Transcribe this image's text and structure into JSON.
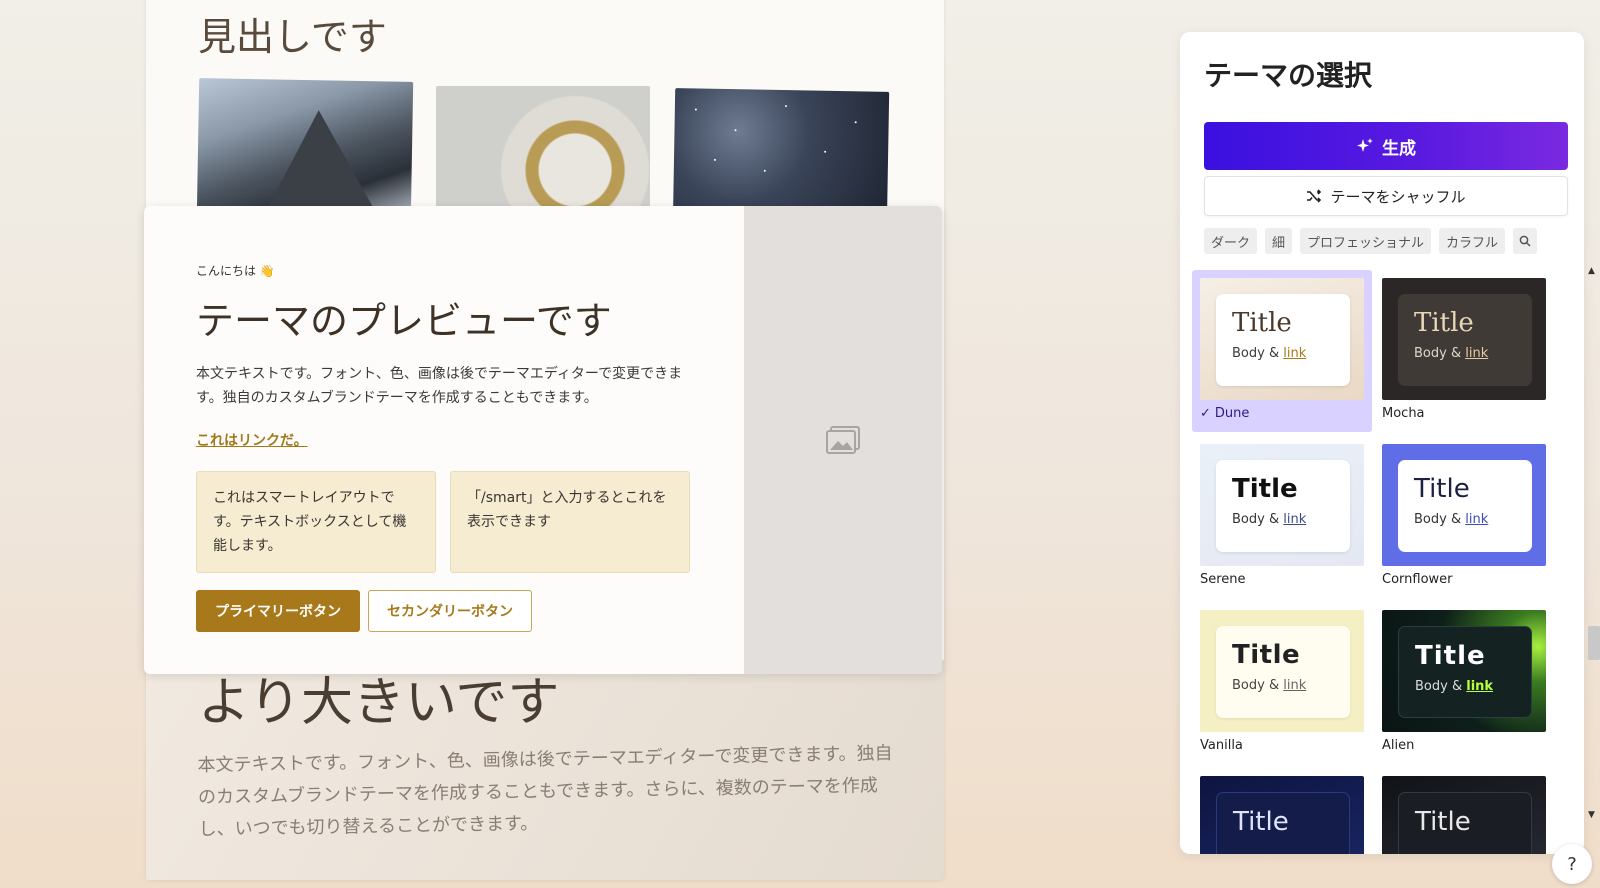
{
  "background_slide": {
    "heading": "見出しです",
    "lower_heading": "より大きいです",
    "lower_body": "本文テキストです。フォント、色、画像は後でテーマエディターで変更できます。独自のカスタムブランドテーマを作成することもできます。さらに、複数のテーマを作成し、いつでも切り替えることができます。"
  },
  "preview": {
    "greeting": "こんにちは 👋",
    "title": "テーマのプレビューです",
    "body": "本文テキストです。フォント、色、画像は後でテーマエディターで変更できます。独自のカスタムブランドテーマを作成することもできます。",
    "link": "これはリンクだ。",
    "smart_box_1": "これはスマートレイアウトです。テキストボックスとして機能します。",
    "smart_box_2": "「/smart」と入力するとこれを表示できます",
    "primary_button": "プライマリーボタン",
    "secondary_button": "セカンダリーボタン",
    "accent_color": "#a8791a"
  },
  "panel": {
    "title": "テーマの選択",
    "generate_button": "生成",
    "shuffle_button": "テーマをシャッフル",
    "filters": [
      "ダーク",
      "細",
      "プロフェッショナル",
      "カラフル"
    ],
    "themes": [
      {
        "name": "Dune",
        "title": "Title",
        "body": "Body &",
        "link": "link",
        "selected": true
      },
      {
        "name": "Mocha",
        "title": "Title",
        "body": "Body &",
        "link": "link",
        "selected": false
      },
      {
        "name": "Serene",
        "title": "Title",
        "body": "Body &",
        "link": "link",
        "selected": false
      },
      {
        "name": "Cornflower",
        "title": "Title",
        "body": "Body &",
        "link": "link",
        "selected": false
      },
      {
        "name": "Vanilla",
        "title": "Title",
        "body": "Body &",
        "link": "link",
        "selected": false
      },
      {
        "name": "Alien",
        "title": "Title",
        "body": "Body &",
        "link": "link",
        "selected": false
      },
      {
        "name": "",
        "title": "Title",
        "body": "",
        "link": "",
        "selected": false
      },
      {
        "name": "",
        "title": "Title",
        "body": "",
        "link": "",
        "selected": false
      }
    ]
  },
  "help_button": "?"
}
